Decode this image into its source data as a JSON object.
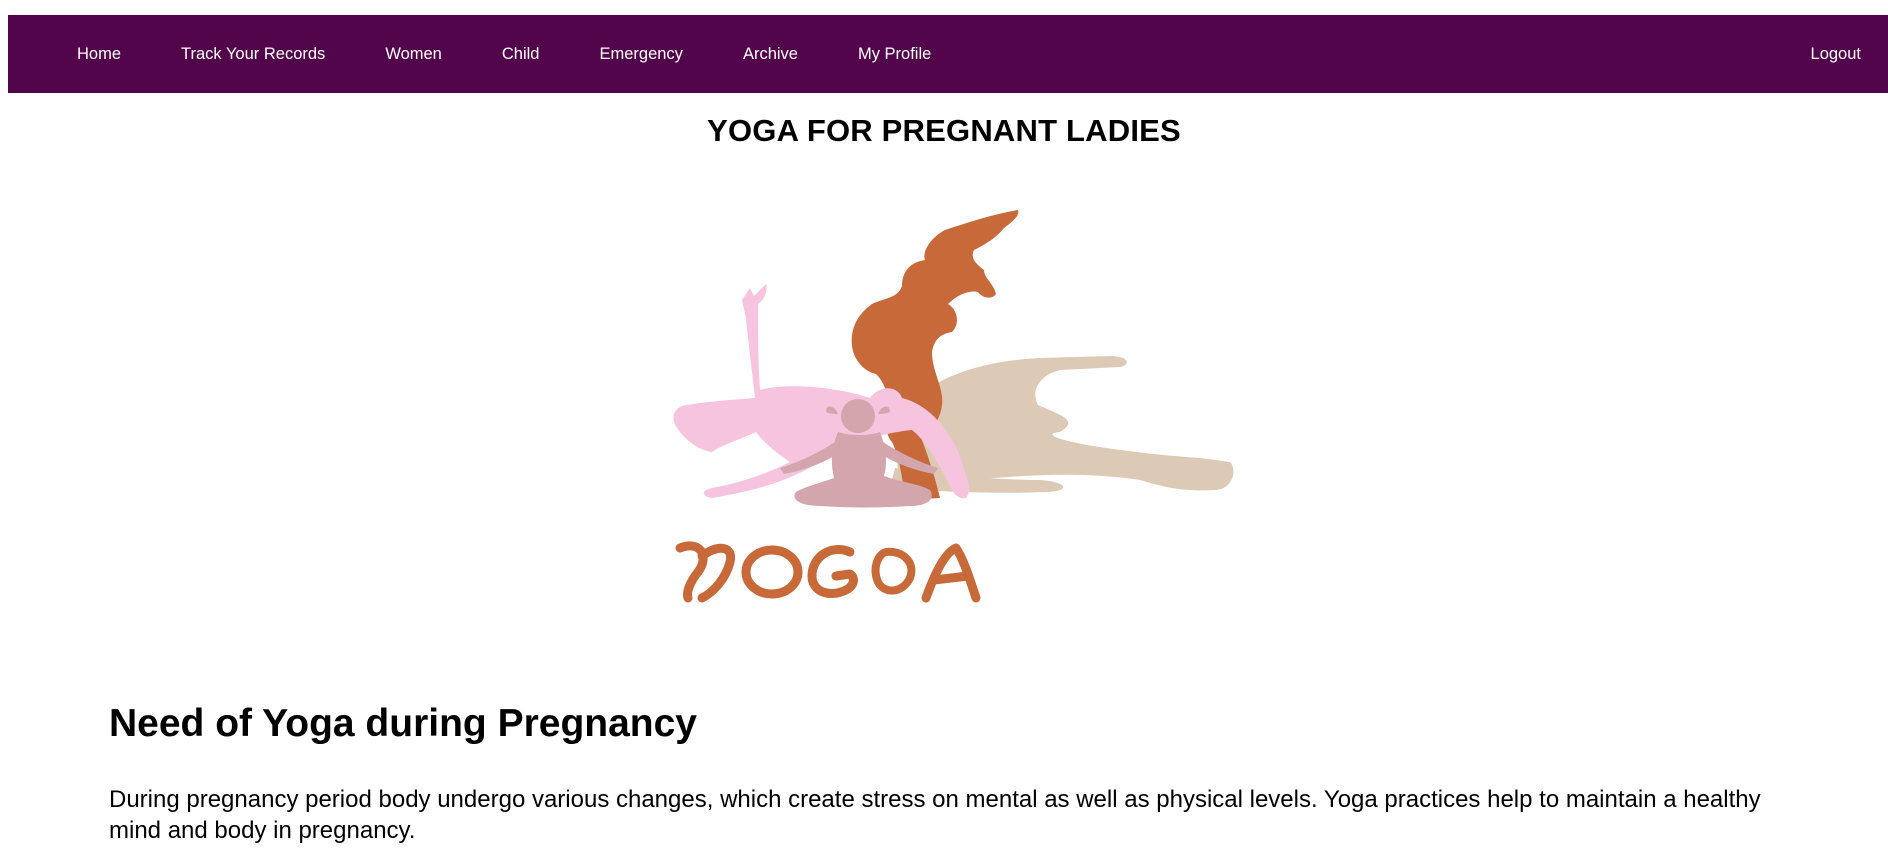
{
  "nav": {
    "items": [
      {
        "label": "Home"
      },
      {
        "label": "Track Your Records"
      },
      {
        "label": "Women"
      },
      {
        "label": "Child"
      },
      {
        "label": "Emergency"
      },
      {
        "label": "Archive"
      },
      {
        "label": "My Profile"
      }
    ],
    "logout_label": "Logout"
  },
  "page": {
    "title": "YOGA FOR PREGNANT LADIES",
    "image": {
      "logo_text": "YOGA"
    },
    "section_heading": "Need of Yoga during Pregnancy",
    "section_text": "During pregnancy period body undergo various changes, which create stress on mental as well as physical levels. Yoga practices help to maintain a healthy mind and body in pregnancy."
  },
  "colors": {
    "nav_background": "#52054b",
    "nav_text": "#ffffff",
    "yoga_orange": "#c8693a",
    "yoga_pink": "#f7c4df",
    "yoga_beige": "#ddcab6",
    "yoga_mauve": "#d2a6ac"
  },
  "icons": {
    "illustration": "yoga-silhouettes-illustration"
  }
}
